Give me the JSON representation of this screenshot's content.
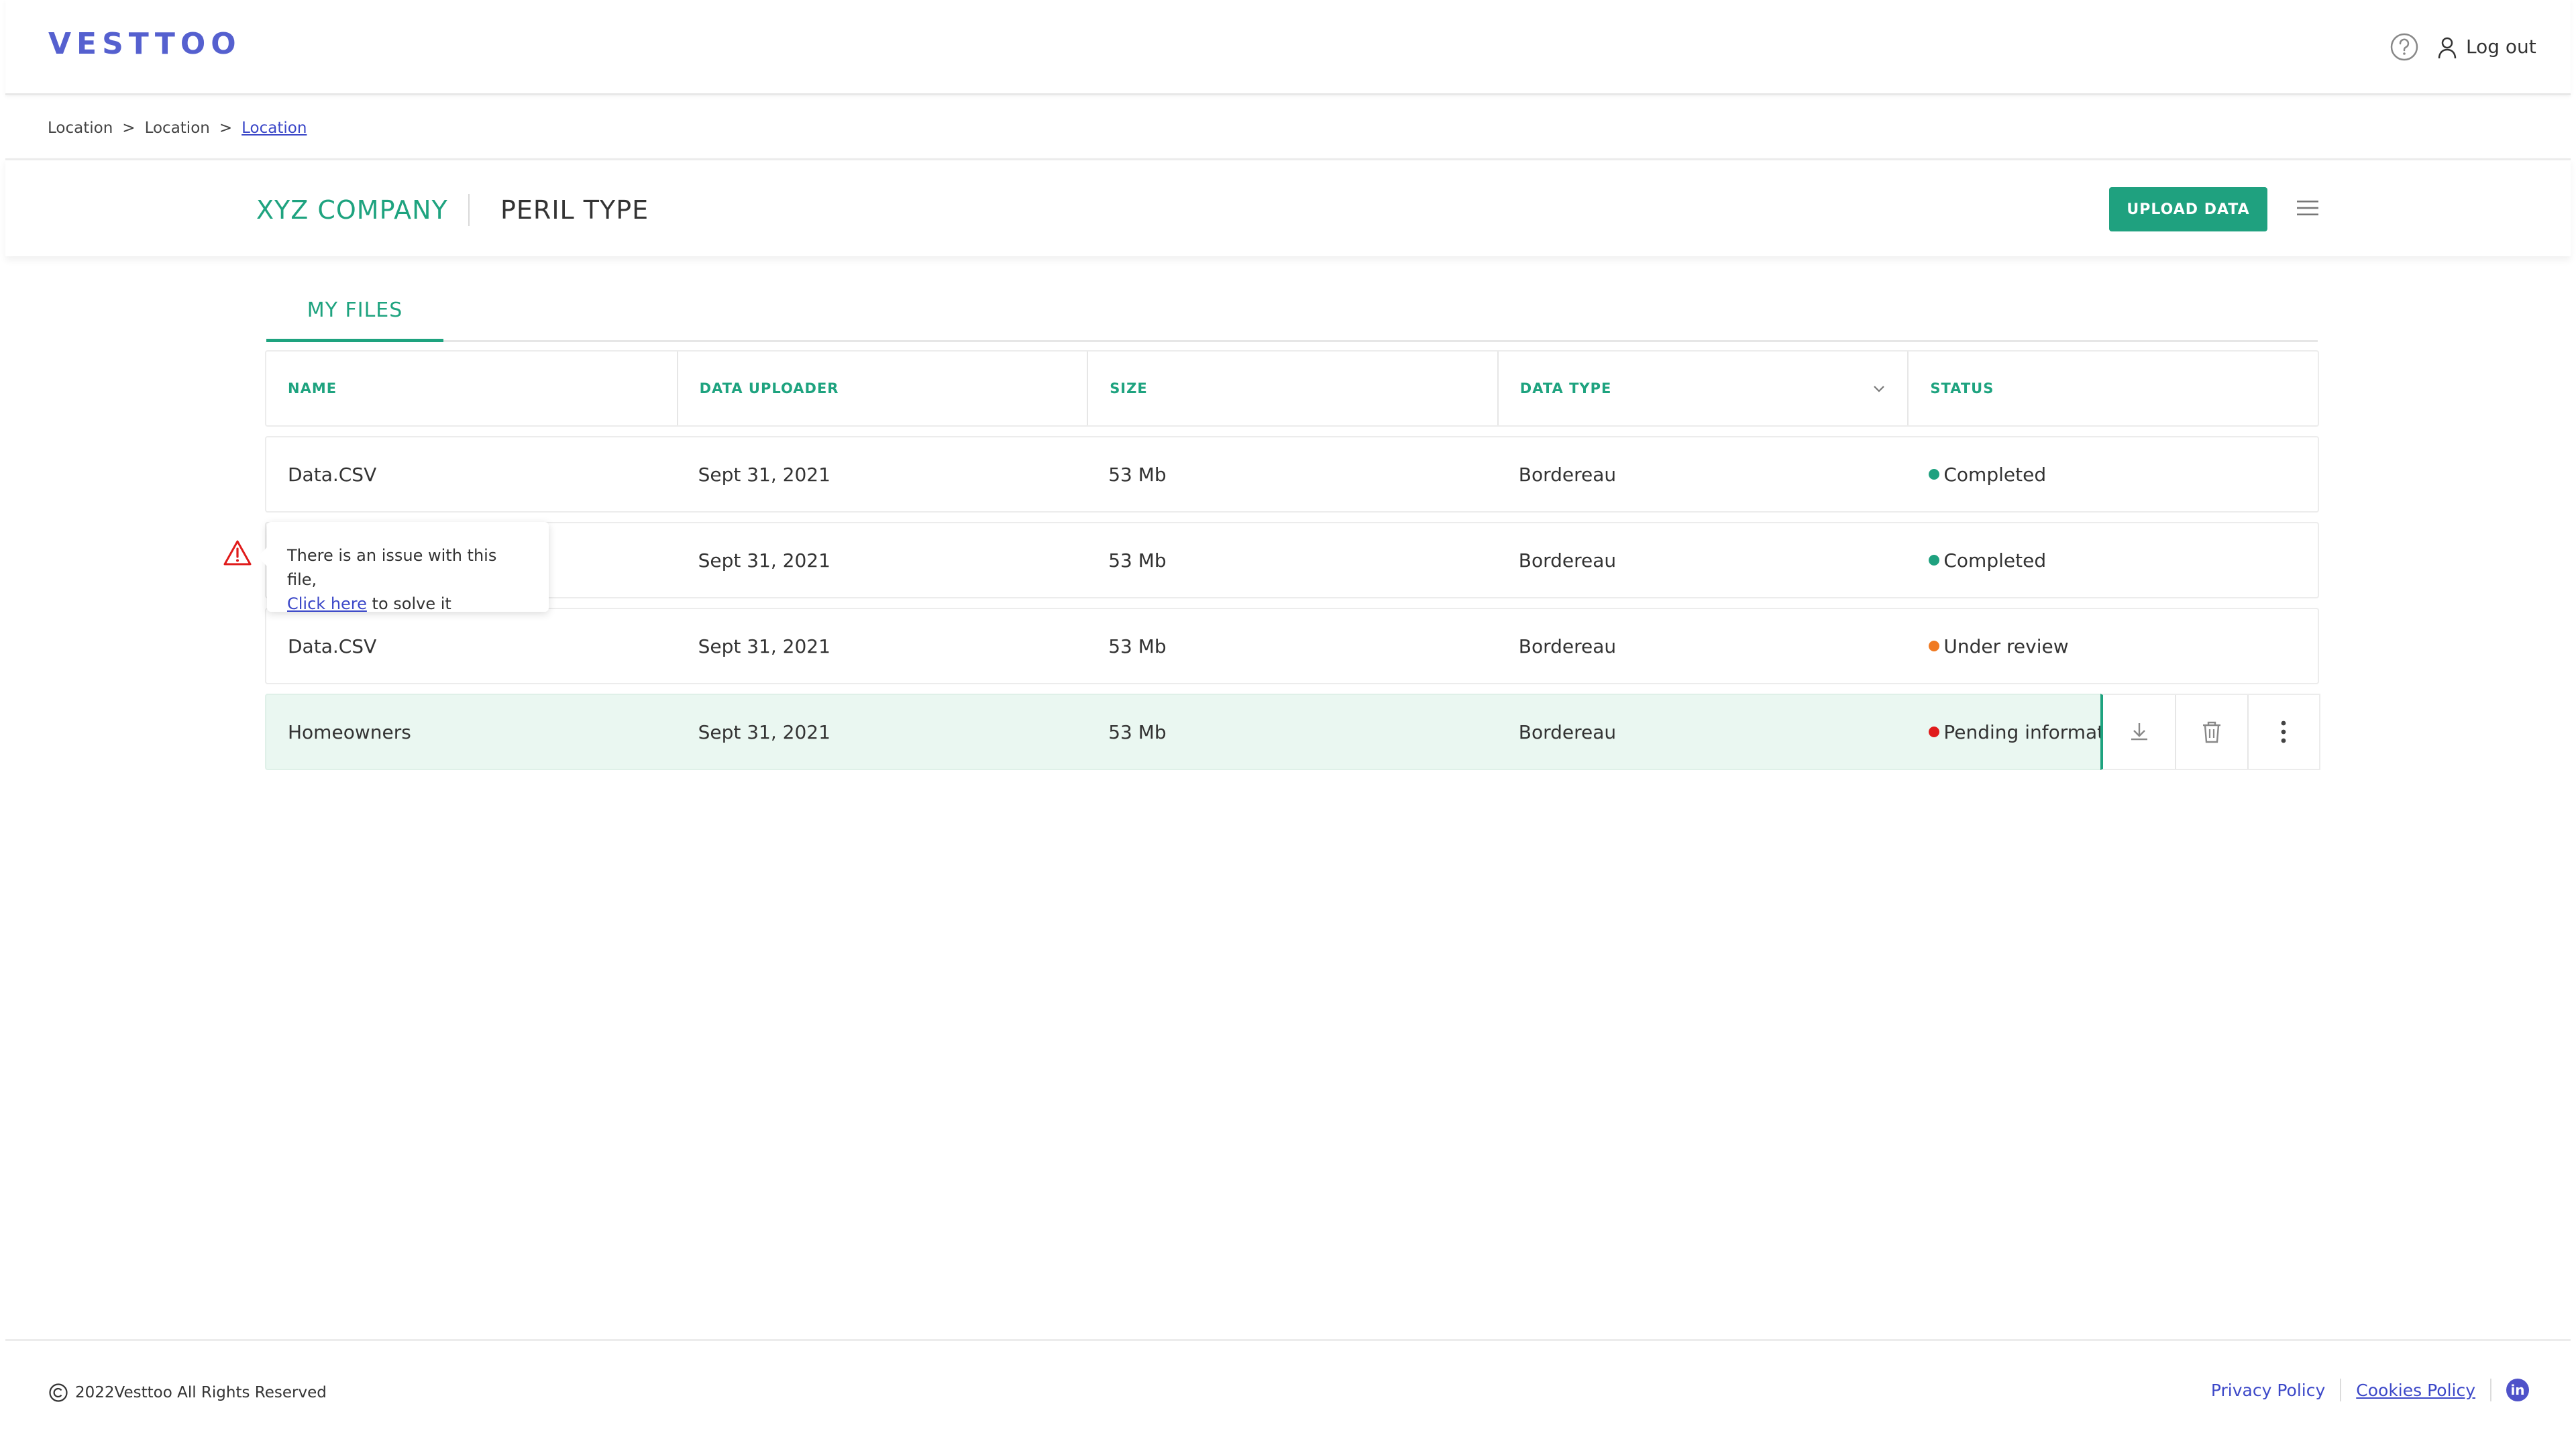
{
  "brand": {
    "logo_text": "VESTTOO",
    "logo_color": "#5560cf",
    "accent": "#1fa17f"
  },
  "topbar": {
    "help_icon": "question-circle-icon",
    "user_icon": "user-icon",
    "logout_label": "Log out"
  },
  "breadcrumb": {
    "items": [
      "Location",
      "Location",
      "Location"
    ],
    "separator": ">"
  },
  "header": {
    "company": "XYZ COMPANY",
    "peril": "PERIL TYPE",
    "upload_label": "UPLOAD DATA",
    "menu_icon": "hamburger-menu-icon"
  },
  "tabs": [
    {
      "label": "MY FILES",
      "active": true
    }
  ],
  "table": {
    "columns": [
      "NAME",
      "DATA UPLOADER",
      "SIZE",
      "DATA TYPE",
      "STATUS"
    ],
    "rows": [
      {
        "name": "Data.CSV",
        "uploader": "Sept 31, 2021",
        "size": "53 Mb",
        "type": "Bordereau",
        "status": "Completed",
        "status_color": "#1fa17f"
      },
      {
        "name": "",
        "uploader": "Sept 31, 2021",
        "size": "53 Mb",
        "type": "Bordereau",
        "status": "Completed",
        "status_color": "#1fa17f"
      },
      {
        "name": "Data.CSV",
        "uploader": "Sept 31, 2021",
        "size": "53 Mb",
        "type": "Bordereau",
        "status": "Under review",
        "status_color": "#f07a22"
      },
      {
        "name": "Homeowners",
        "uploader": "Sept 31, 2021",
        "size": "53 Mb",
        "type": "Bordereau",
        "status": "Pending information",
        "status_color": "#e01b1b"
      }
    ],
    "row_actions": [
      "download-icon",
      "trash-icon",
      "more-vertical-icon"
    ]
  },
  "tooltip": {
    "line1": "There is an issue with this file,",
    "link": "Click here",
    "line2_rest": " to solve it",
    "icon": "warning-triangle-icon",
    "icon_color": "#e01b1b"
  },
  "footer": {
    "copyright_icon": "copyright-icon",
    "copyright": "2022Vesttoo All Rights Reserved",
    "privacy": "Privacy Policy",
    "cookies": "Cookies Policy",
    "linkedin": "in"
  }
}
